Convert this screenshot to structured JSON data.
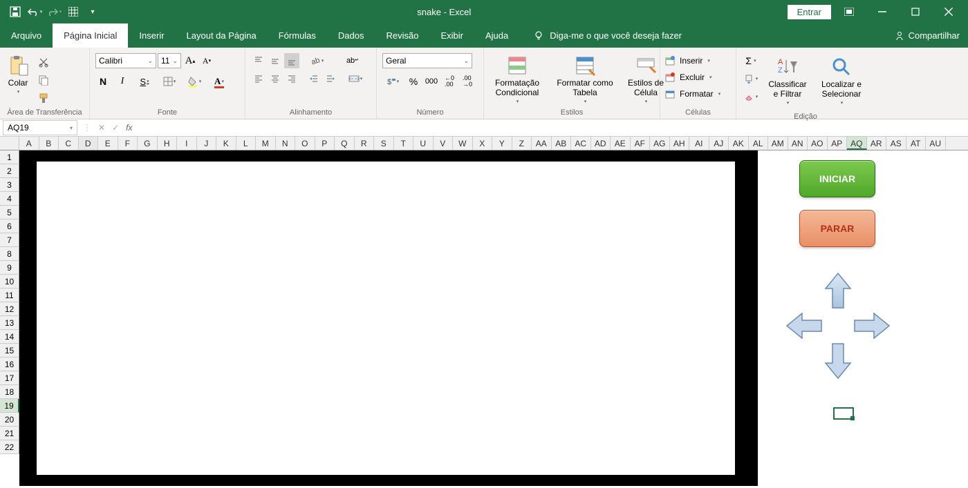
{
  "title": "snake  -  Excel",
  "signin": "Entrar",
  "tabs": {
    "file": "Arquivo",
    "home": "Página Inicial",
    "insert": "Inserir",
    "layout": "Layout da Página",
    "formulas": "Fórmulas",
    "data": "Dados",
    "review": "Revisão",
    "view": "Exibir",
    "help": "Ajuda"
  },
  "tellme": "Diga-me o que você deseja fazer",
  "share": "Compartilhar",
  "ribbon": {
    "clipboard": {
      "paste": "Colar",
      "group": "Área de Transferência"
    },
    "font": {
      "name": "Calibri",
      "size": "11",
      "group": "Fonte",
      "bold": "N",
      "italic": "I",
      "underline": "S"
    },
    "alignment": {
      "group": "Alinhamento",
      "wrap": "ab"
    },
    "number": {
      "format": "Geral",
      "group": "Número"
    },
    "styles": {
      "cond": "Formatação Condicional",
      "table": "Formatar como Tabela",
      "cell": "Estilos de Célula",
      "group": "Estilos"
    },
    "cells": {
      "insert": "Inserir",
      "delete": "Excluir",
      "format": "Formatar",
      "group": "Células"
    },
    "editing": {
      "sort": "Classificar e Filtrar",
      "find": "Localizar e Selecionar",
      "group": "Edição"
    }
  },
  "namebox": "AQ19",
  "columns": [
    "A",
    "B",
    "C",
    "D",
    "E",
    "F",
    "G",
    "H",
    "I",
    "J",
    "K",
    "L",
    "M",
    "N",
    "O",
    "P",
    "Q",
    "R",
    "S",
    "T",
    "U",
    "V",
    "W",
    "X",
    "Y",
    "Z",
    "AA",
    "AB",
    "AC",
    "AD",
    "AE",
    "AF",
    "AG",
    "AH",
    "AI",
    "AJ",
    "AK",
    "AL",
    "AM",
    "AN",
    "AO",
    "AP",
    "AQ",
    "AR",
    "AS",
    "AT",
    "AU"
  ],
  "rows": [
    "1",
    "2",
    "3",
    "4",
    "5",
    "6",
    "7",
    "8",
    "9",
    "10",
    "11",
    "12",
    "13",
    "14",
    "15",
    "16",
    "17",
    "18",
    "19",
    "20",
    "21",
    "22"
  ],
  "selected_col": "AQ",
  "selected_row": "19",
  "selected_col_light": "D",
  "game": {
    "start": "INICIAR",
    "stop": "PARAR"
  },
  "colors": {
    "excel_green": "#217346"
  }
}
